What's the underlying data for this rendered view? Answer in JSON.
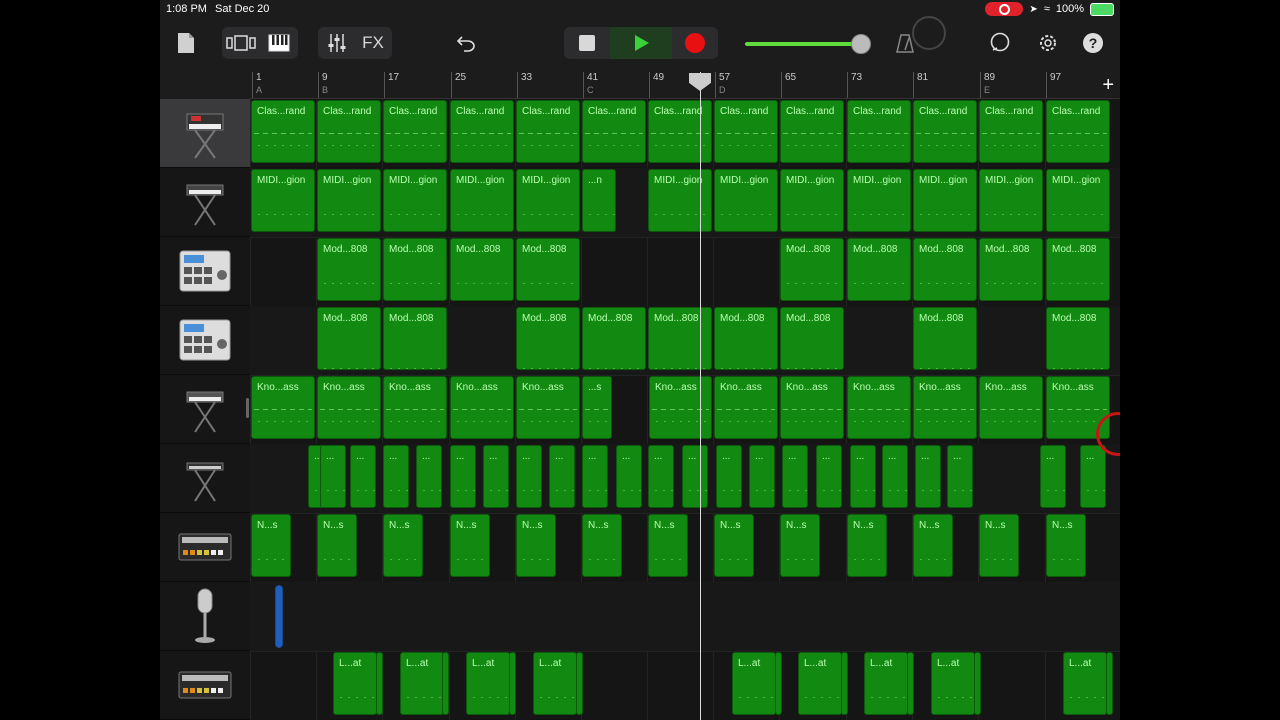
{
  "status_bar": {
    "time": "1:08 PM",
    "date": "Sat Dec 20",
    "battery": "100%"
  },
  "toolbar": {
    "fx_label": "FX"
  },
  "ruler": {
    "bars": [
      {
        "num": "1",
        "sec": "A"
      },
      {
        "num": "9",
        "sec": "B"
      },
      {
        "num": "17",
        "sec": ""
      },
      {
        "num": "25",
        "sec": ""
      },
      {
        "num": "33",
        "sec": ""
      },
      {
        "num": "41",
        "sec": "C"
      },
      {
        "num": "49",
        "sec": ""
      },
      {
        "num": "57",
        "sec": "D"
      },
      {
        "num": "65",
        "sec": ""
      },
      {
        "num": "73",
        "sec": ""
      },
      {
        "num": "81",
        "sec": ""
      },
      {
        "num": "89",
        "sec": "E"
      },
      {
        "num": "97",
        "sec": ""
      }
    ],
    "add_label": "+"
  },
  "tracks": [
    {
      "icon": "synth-keyboard-icon",
      "label": "Clas...rand",
      "selected": true
    },
    {
      "icon": "synth-keyboard-icon",
      "label": "MIDI...gion"
    },
    {
      "icon": "drum-machine-icon",
      "label": "Mod...808"
    },
    {
      "icon": "drum-machine-icon",
      "label": "Mod...808"
    },
    {
      "icon": "synth-keyboard-icon",
      "label": "Kno...ass"
    },
    {
      "icon": "synth-keyboard-icon",
      "label": "..."
    },
    {
      "icon": "beat-machine-icon",
      "label": "N...s"
    },
    {
      "icon": "microphone-icon",
      "label": ""
    },
    {
      "icon": "beat-machine-icon",
      "label": "L...at"
    }
  ],
  "region_labels": {
    "t0": "Clas...rand",
    "t1": "MIDI...gion",
    "t1_short": "...n",
    "t2": "Mod...808",
    "t4": "Kno...ass",
    "t4_short": "...s",
    "t5": "...",
    "t6": "N...s",
    "t8": "L...at"
  },
  "colors": {
    "region_green": "#128a12",
    "audio_blue": "#1e5fc0",
    "record_red": "#e0222a",
    "play_green": "#3ad13a"
  }
}
